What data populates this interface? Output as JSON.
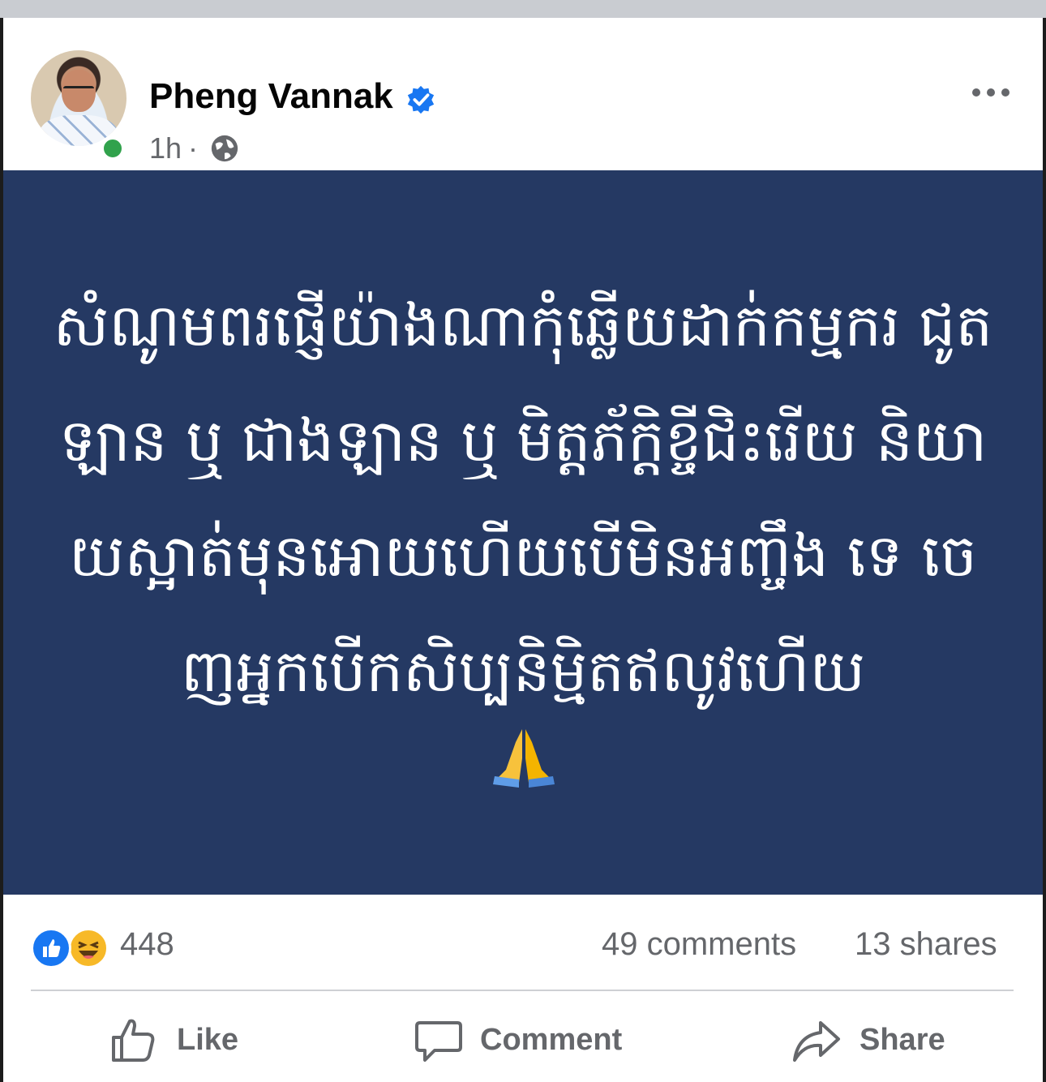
{
  "post": {
    "author": "Pheng Vannak",
    "verified": true,
    "time": "1h",
    "separator": "·",
    "privacy_icon": "globe-icon",
    "more_icon": "more-horizontal-icon",
    "text": "សំណូមពរផ្ញើយ៉ាងណាកុំឆ្លើយដាក់កម្មករ ជូតឡាន ឬ ជាងឡាន ឬ មិត្តភ័ក្តិខ្ចីជិះរើយ និយាយស្អាត់មុនអោយហើយបើមិនអញ្ចឹង ទេ ចេញអ្នកបើកសិប្បនិម្មិតឥលូវហើយ",
    "emoji": "🙏",
    "card_color": "#253963"
  },
  "stats": {
    "reactions": "448",
    "reaction_icons": [
      "like-reaction-icon",
      "haha-reaction-icon"
    ],
    "comments": "49 comments",
    "shares": "13 shares"
  },
  "actions": {
    "like": "Like",
    "comment": "Comment",
    "share": "Share"
  },
  "colors": {
    "brand_blue": "#1877f2",
    "secondary_text": "#65676b",
    "online_green": "#31a24c"
  }
}
